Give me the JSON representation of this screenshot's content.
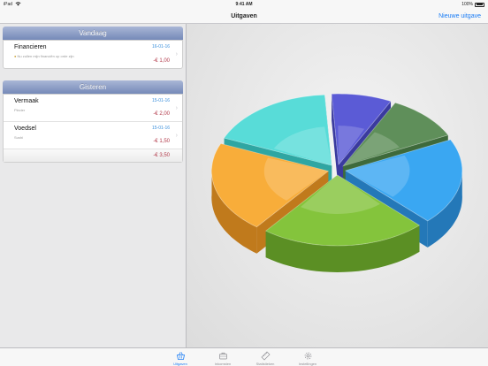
{
  "status_bar": {
    "device": "iPad",
    "time": "9:41 AM",
    "battery": "100%"
  },
  "navbar": {
    "title": "Uitgaven",
    "action": "Nieuwe uitgave"
  },
  "sections": [
    {
      "header": "Vandaag",
      "rows": [
        {
          "name": "Financieren",
          "subtitle": "Nu zullen mijn financiën op orde zijn",
          "date": "16-01-16",
          "amount": "-€ 1,00"
        }
      ]
    },
    {
      "header": "Gisteren",
      "rows": [
        {
          "name": "Vermaak",
          "subtitle": "Plezier",
          "date": "15-01-16",
          "amount": "-€ 2,00"
        },
        {
          "name": "Voedsel",
          "subtitle": "Sushi",
          "date": "15-01-16",
          "amount": "-€ 1,50"
        }
      ],
      "total": "-€ 3,50"
    }
  ],
  "pie": {
    "slices": [
      {
        "value": 8,
        "color": "#5b5bd6",
        "side": "#3a3a9e",
        "explode": 1
      },
      {
        "value": 10,
        "color": "#5f8f5a",
        "side": "#3e6a3b",
        "explode": 1
      },
      {
        "value": 19,
        "color": "#3aa7f2",
        "side": "#2478b8",
        "explode": 1
      },
      {
        "value": 22,
        "color": "#84c43c",
        "side": "#5b8f24",
        "explode": 1
      },
      {
        "value": 20,
        "color": "#f8ad3a",
        "side": "#c07a1c",
        "explode": 1
      },
      {
        "value": 17,
        "color": "#58dcd8",
        "side": "#2fa6a2",
        "explode": 1
      }
    ]
  },
  "tabs": [
    {
      "label": "Uitgaven",
      "icon": "basket-icon",
      "active": true
    },
    {
      "label": "Inkomsten",
      "icon": "briefcase-icon",
      "active": false
    },
    {
      "label": "Statistieken",
      "icon": "ruler-icon",
      "active": false
    },
    {
      "label": "Instellingen",
      "icon": "gear-icon",
      "active": false
    }
  ]
}
